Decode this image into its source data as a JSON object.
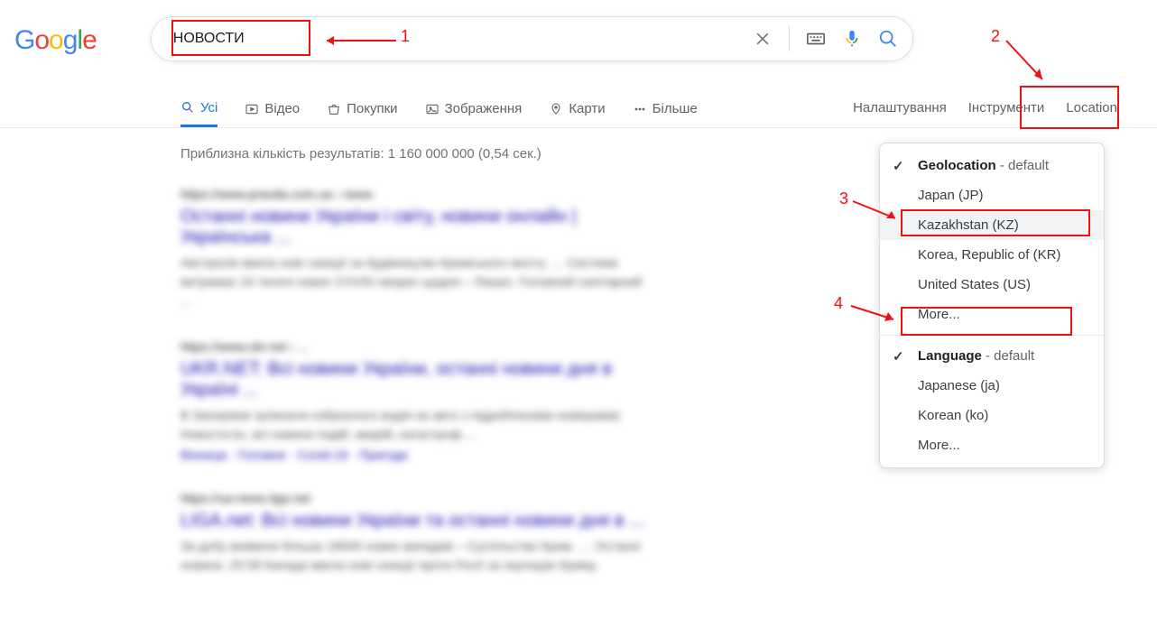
{
  "search": {
    "query": "НОВОСТИ"
  },
  "nav": {
    "all": "Усі",
    "video": "Відео",
    "shopping": "Покупки",
    "images": "Зображення",
    "maps": "Карти",
    "more": "Більше",
    "settings": "Налаштування",
    "tools": "Інструменти",
    "location": "Location"
  },
  "stats": "Приблизна кількість результатів: 1 160 000 000 (0,54 сек.)",
  "location_panel": {
    "geo_header_b": "Geolocation",
    "geo_header_rest": " - default",
    "items": {
      "jp": "Japan (JP)",
      "kz": "Kazakhstan (KZ)",
      "kr": "Korea, Republic of (KR)",
      "us": "United States (US)",
      "more": "More..."
    },
    "lang_header_b": "Language",
    "lang_header_rest": " - default",
    "lang_items": {
      "ja": "Japanese (ja)",
      "ko": "Korean (ko)",
      "more": "More..."
    }
  },
  "annotations": {
    "n1": "1",
    "n2": "2",
    "n3": "3",
    "n4": "4"
  },
  "results": {
    "r1": {
      "url": "https://www.pravda.com.ua › news",
      "title": "Останні новини України і світу, новини онлайн | Українська ...",
      "snip": "Австралія ввела нові санкції за будівництво Кримського мосту. … Система витримає 24 тисячі нових COVID-хворих щодня – Ляшко. Головний санітарний ..."
    },
    "r2": {
      "url": "https://www.ukr.net › ...",
      "title": "UKR.NET: Всі новини України, останні новини дня в Україні ...",
      "snip": "В Запоріжжі зупинили озброєного водія на авто з підробленими номерами|Новости.kz, всі новини подій, аварій, катастроф ...",
      "links": "Вінниця · Головне · Covid-19 · Пригоди"
    },
    "r3": {
      "url": "https://ua-news.liga.net",
      "title": "LIGA.net: Всі новини України та останні новини дня в ...",
      "snip": "За добу виявили більше 18000 нових випадків – Суспільство Крим. … Останні новини. 20:58  Канада ввела нові санкції проти РосІї за окупацію Криму."
    }
  }
}
